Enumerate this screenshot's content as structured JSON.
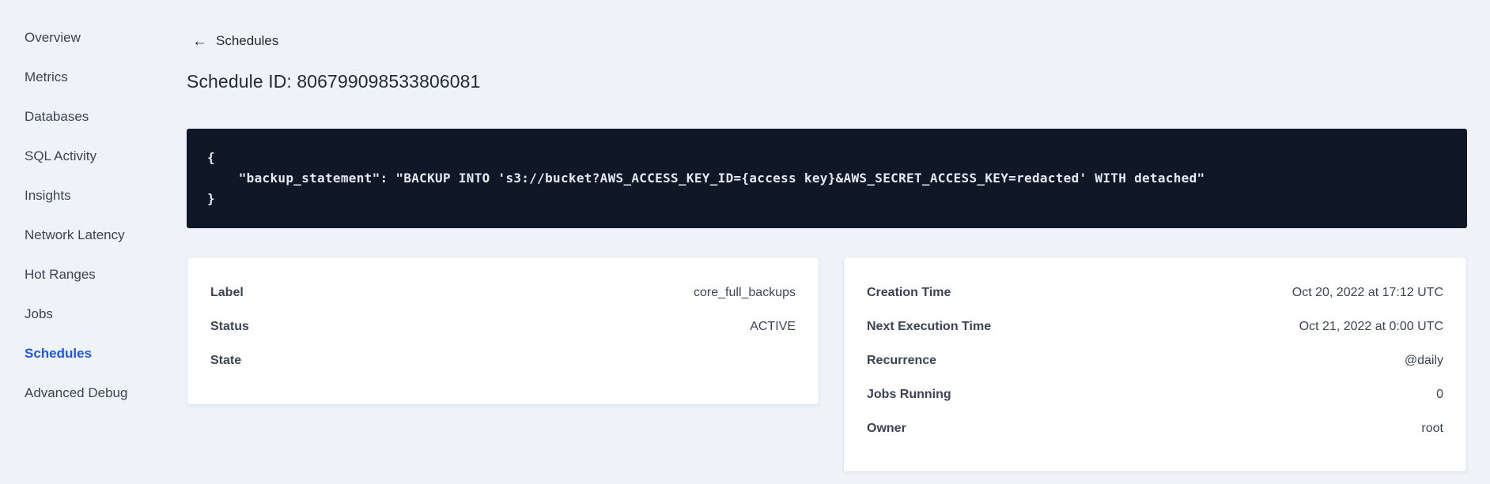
{
  "sidebar": {
    "items": [
      {
        "label": "Overview",
        "active": false
      },
      {
        "label": "Metrics",
        "active": false
      },
      {
        "label": "Databases",
        "active": false
      },
      {
        "label": "SQL Activity",
        "active": false
      },
      {
        "label": "Insights",
        "active": false
      },
      {
        "label": "Network Latency",
        "active": false
      },
      {
        "label": "Hot Ranges",
        "active": false
      },
      {
        "label": "Jobs",
        "active": false
      },
      {
        "label": "Schedules",
        "active": true
      },
      {
        "label": "Advanced Debug",
        "active": false
      }
    ]
  },
  "header": {
    "back_icon": "←",
    "back_label": "Schedules",
    "title": "Schedule ID: 806799098533806081"
  },
  "code_block": {
    "line1": "{",
    "line2": "    \"backup_statement\": \"BACKUP INTO 's3://bucket?AWS_ACCESS_KEY_ID={access key}&AWS_SECRET_ACCESS_KEY=redacted' WITH detached\"",
    "line3": "}"
  },
  "details_card": {
    "rows": [
      {
        "label": "Label",
        "value": "core_full_backups"
      },
      {
        "label": "Status",
        "value": "ACTIVE"
      },
      {
        "label": "State",
        "value": ""
      }
    ]
  },
  "schedule_card": {
    "rows": [
      {
        "label": "Creation Time",
        "value": "Oct 20, 2022 at 17:12 UTC"
      },
      {
        "label": "Next Execution Time",
        "value": "Oct 21, 2022 at 0:00 UTC"
      },
      {
        "label": "Recurrence",
        "value": "@daily"
      },
      {
        "label": "Jobs Running",
        "value": "0"
      },
      {
        "label": "Owner",
        "value": "root"
      }
    ]
  },
  "colors": {
    "bg": "#eff3f8",
    "accent": "#2155f0",
    "code-bg": "#101726",
    "code-text": "#e4eaf2",
    "text-dark": "#242a35",
    "text-slate": "#394455"
  }
}
